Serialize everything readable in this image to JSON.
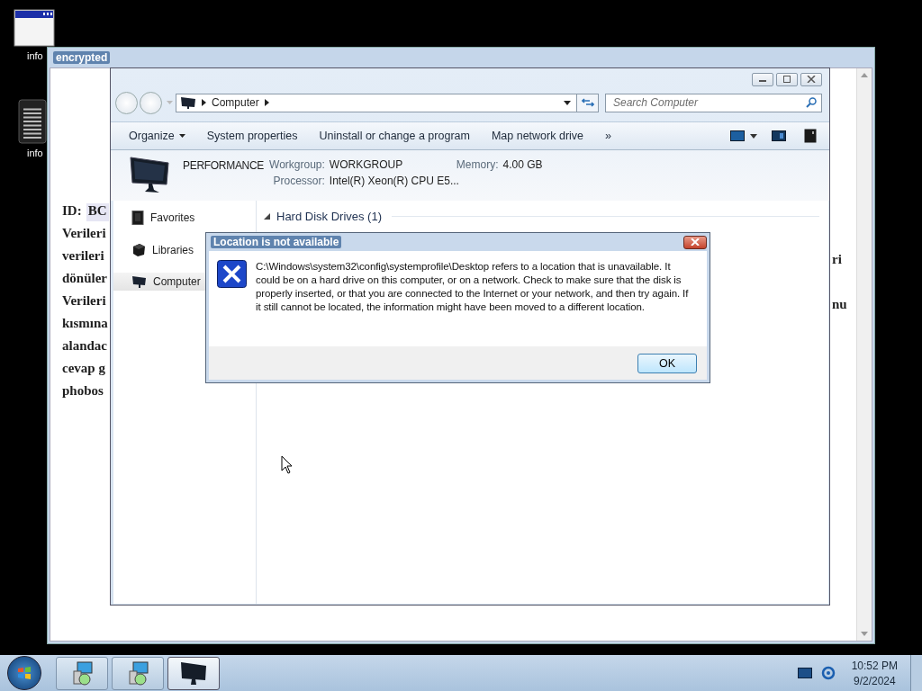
{
  "desktop_icons": [
    {
      "label": "info",
      "kind": "window"
    },
    {
      "label": "info",
      "kind": "document"
    }
  ],
  "back_window": {
    "title": "encrypted",
    "id_label": "ID:",
    "id_value": "BC",
    "left_text": [
      "Verileri",
      "verileri",
      "dönüler",
      "Verileri",
      "kısmına",
      "alandac",
      "cevap g",
      "phobos"
    ],
    "right_text": [
      "ri",
      "nu"
    ]
  },
  "explorer": {
    "address": [
      "Computer"
    ],
    "search": {
      "placeholder": "Search Computer"
    },
    "toolbar": [
      {
        "label": "Organize",
        "dropdown": true
      },
      {
        "label": "System properties",
        "dropdown": false
      },
      {
        "label": "Uninstall or change a program",
        "dropdown": false
      },
      {
        "label": "Map network drive",
        "dropdown": false
      }
    ],
    "overflow": "»",
    "computer_name": "PERFORMANCE",
    "details": [
      {
        "label": "Workgroup:",
        "value": "WORKGROUP"
      },
      {
        "label": "Memory:",
        "value": "4.00 GB"
      },
      {
        "label": "Processor:",
        "value": "Intel(R) Xeon(R) CPU E5..."
      }
    ],
    "nav": [
      {
        "label": "Favorites",
        "kind": "favorites",
        "selected": false
      },
      {
        "label": "Libraries",
        "kind": "libraries",
        "selected": false
      },
      {
        "label": "Computer",
        "kind": "computer",
        "selected": true
      }
    ],
    "group": {
      "title": "Hard Disk Drives (1)",
      "expanded": true
    }
  },
  "dialog": {
    "title": "Location is not available",
    "message": "C:\\Windows\\system32\\config\\systemprofile\\Desktop refers to a location that is unavailable. It could be on a hard drive on this computer, or on a network. Check to make sure that the disk is properly inserted, or that you are connected to the Internet or your network, and then try again. If it still cannot be located, the information might have been moved to a different location.",
    "buttons": [
      "OK"
    ]
  },
  "taskbar": {
    "tasks": [
      {
        "kind": "installer",
        "selected": false
      },
      {
        "kind": "installer",
        "selected": false
      },
      {
        "kind": "computer",
        "selected": true
      }
    ],
    "time": "10:52 PM",
    "date": "9/2/2024"
  }
}
